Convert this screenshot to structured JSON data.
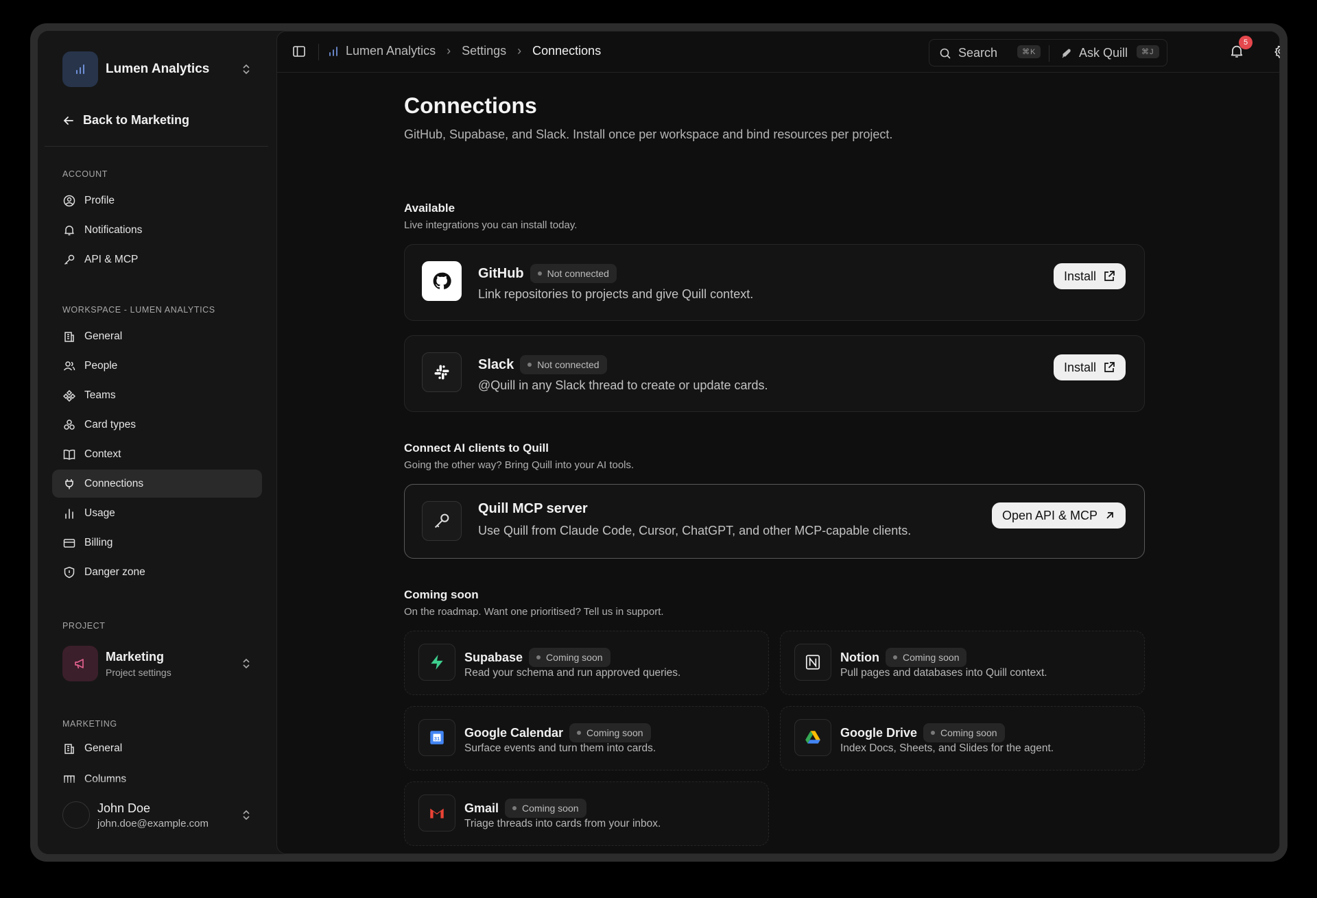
{
  "sidebar": {
    "workspace_name": "Lumen Analytics",
    "back_label": "Back to Marketing",
    "account_label": "ACCOUNT",
    "account_items": [
      {
        "label": "Profile",
        "icon": "user-circle-icon"
      },
      {
        "label": "Notifications",
        "icon": "bell-icon"
      },
      {
        "label": "API & MCP",
        "icon": "key-icon"
      }
    ],
    "workspace_label": "WORKSPACE - LUMEN ANALYTICS",
    "workspace_items": [
      {
        "label": "General",
        "icon": "building-icon"
      },
      {
        "label": "People",
        "icon": "people-icon"
      },
      {
        "label": "Teams",
        "icon": "teams-icon"
      },
      {
        "label": "Card types",
        "icon": "shapes-icon"
      },
      {
        "label": "Context",
        "icon": "book-icon"
      },
      {
        "label": "Connections",
        "icon": "plug-icon",
        "active": true
      },
      {
        "label": "Usage",
        "icon": "bar-chart-icon"
      },
      {
        "label": "Billing",
        "icon": "credit-card-icon"
      },
      {
        "label": "Danger zone",
        "icon": "shield-icon"
      }
    ],
    "project_label": "PROJECT",
    "project": {
      "name": "Marketing",
      "sub": "Project settings"
    },
    "marketing_label": "MARKETING",
    "marketing_items": [
      {
        "label": "General",
        "icon": "building-icon"
      },
      {
        "label": "Columns",
        "icon": "columns-icon"
      }
    ],
    "user": {
      "name": "John Doe",
      "email": "john.doe@example.com"
    }
  },
  "topbar": {
    "breadcrumbs": [
      "Lumen Analytics",
      "Settings",
      "Connections"
    ],
    "search_label": "Search",
    "search_kbd": "⌘K",
    "ask_label": "Ask Quill",
    "ask_kbd": "⌘J",
    "notification_count": "5"
  },
  "page": {
    "title": "Connections",
    "subtitle": "GitHub, Supabase, and Slack. Install once per workspace and bind resources per project.",
    "available": {
      "title": "Available",
      "subtitle": "Live integrations you can install today.",
      "items": [
        {
          "name": "GitHub",
          "status": "Not connected",
          "desc": "Link repositories to projects and give Quill context.",
          "button": "Install"
        },
        {
          "name": "Slack",
          "status": "Not connected",
          "desc": "@Quill in any Slack thread to create or update cards.",
          "button": "Install"
        }
      ]
    },
    "ai_clients": {
      "title": "Connect AI clients to Quill",
      "subtitle": "Going the other way? Bring Quill into your AI tools.",
      "item": {
        "name": "Quill MCP server",
        "desc": "Use Quill from Claude Code, Cursor, ChatGPT, and other MCP-capable clients.",
        "button": "Open API & MCP"
      }
    },
    "coming_soon": {
      "title": "Coming soon",
      "subtitle": "On the roadmap. Want one prioritised? Tell us in support.",
      "items": [
        {
          "name": "Supabase",
          "status": "Coming soon",
          "desc": "Read your schema and run approved queries."
        },
        {
          "name": "Notion",
          "status": "Coming soon",
          "desc": "Pull pages and databases into Quill context."
        },
        {
          "name": "Google Calendar",
          "status": "Coming soon",
          "desc": "Surface events and turn them into cards."
        },
        {
          "name": "Google Drive",
          "status": "Coming soon",
          "desc": "Index Docs, Sheets, and Slides for the agent."
        },
        {
          "name": "Gmail",
          "status": "Coming soon",
          "desc": "Triage threads into cards from your inbox."
        }
      ]
    }
  },
  "colors": {
    "accent_supabase": "#3ecf8e",
    "accent_badge": "#e5484d",
    "accent_gmail": "#ea4335",
    "accent_calendar": "#4285f4"
  }
}
